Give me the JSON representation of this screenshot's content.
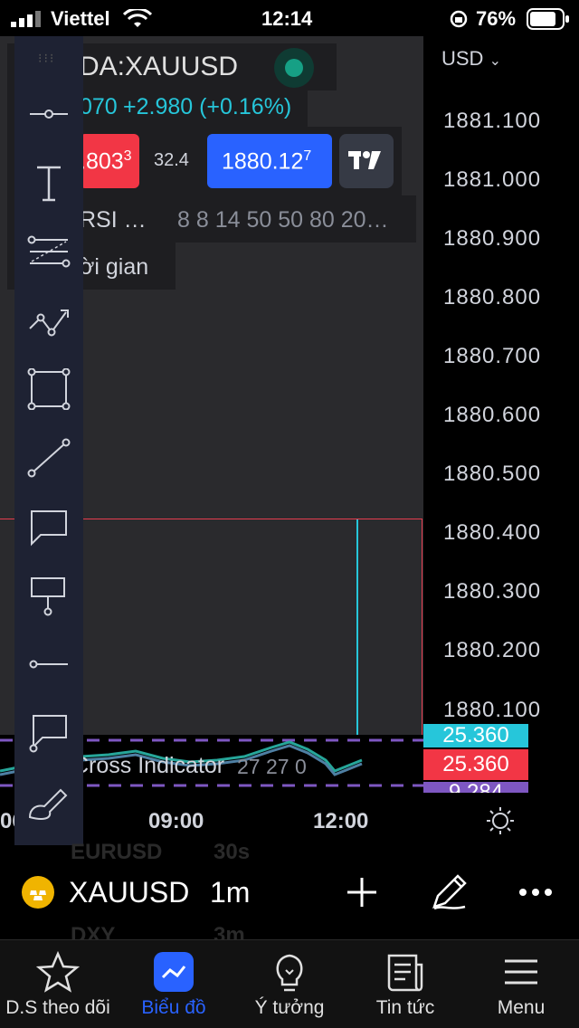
{
  "status_bar": {
    "carrier": "Viettel",
    "time": "12:14",
    "battery": "76%"
  },
  "header": {
    "symbol": "DA:XAUUSD",
    "change_partial": "070",
    "change": "+2.980 (+0.16%)",
    "sell_price": ".803",
    "sell_sup": "3",
    "spread": "32.4",
    "buy_price": "1880.12",
    "buy_sup": "7",
    "indicator": "RSI …",
    "indicator_params": "8 8 14 50 50 80 20…",
    "time_label": "ời gian"
  },
  "price_axis": {
    "currency": "USD",
    "labels": [
      "1881.100",
      "1881.000",
      "1880.900",
      "1880.800",
      "1880.700",
      "1880.600",
      "1880.500",
      "1880.400",
      "1880.300",
      "1880.200",
      "1880.100"
    ]
  },
  "indicator_pane": {
    "label": "Cross Indicator",
    "params": "27 27 0",
    "tag_top": "25.360",
    "tag_mid": "25.360",
    "tag_bottom": "9.284"
  },
  "time_axis": {
    "left_partial": "06",
    "labels": [
      "09:00",
      "12:00"
    ]
  },
  "symbol_bar": {
    "symbol": "XAUUSD",
    "interval": "1m",
    "ghost_top_symbol": "EURUSD",
    "ghost_top_interval": "30s",
    "ghost_bottom_symbol": "DXY",
    "ghost_bottom_interval": "3m"
  },
  "nav": {
    "items": [
      {
        "label": "D.S theo dõi",
        "icon": "star-icon"
      },
      {
        "label": "Biểu đồ",
        "icon": "chart-icon"
      },
      {
        "label": "Ý tưởng",
        "icon": "lightbulb-icon"
      },
      {
        "label": "Tin tức",
        "icon": "news-icon"
      },
      {
        "label": "Menu",
        "icon": "menu-icon"
      }
    ]
  },
  "colors": {
    "accent": "#2962ff",
    "sell": "#f23645",
    "up": "#26c6da",
    "toolbar": "#1e2233"
  }
}
